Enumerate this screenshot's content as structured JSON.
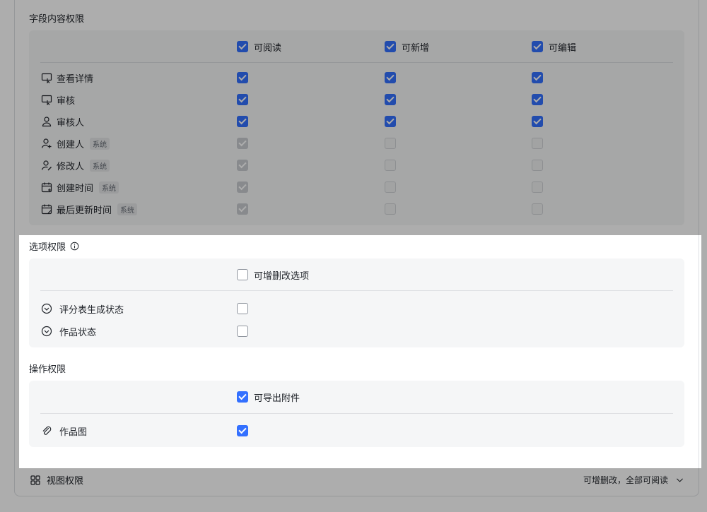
{
  "field_content": {
    "title": "字段内容权限",
    "columns": [
      {
        "label": "可阅读",
        "checked": true
      },
      {
        "label": "可新增",
        "checked": true
      },
      {
        "label": "可编辑",
        "checked": true
      }
    ],
    "rows": [
      {
        "label": "查看详情",
        "icon": "button-field-icon",
        "tag": "",
        "values": [
          true,
          true,
          true
        ],
        "disabled": false
      },
      {
        "label": "审核",
        "icon": "button-field-icon",
        "tag": "",
        "values": [
          true,
          true,
          true
        ],
        "disabled": false
      },
      {
        "label": "审核人",
        "icon": "person-icon",
        "tag": "",
        "values": [
          true,
          true,
          true
        ],
        "disabled": false
      },
      {
        "label": "创建人",
        "icon": "person-add-icon",
        "tag": "系统",
        "values": [
          true,
          false,
          false
        ],
        "disabled": true
      },
      {
        "label": "修改人",
        "icon": "person-edit-icon",
        "tag": "系统",
        "values": [
          true,
          false,
          false
        ],
        "disabled": true
      },
      {
        "label": "创建时间",
        "icon": "calendar-add-icon",
        "tag": "系统",
        "values": [
          true,
          false,
          false
        ],
        "disabled": true
      },
      {
        "label": "最后更新时间",
        "icon": "calendar-edit-icon",
        "tag": "系统",
        "values": [
          true,
          false,
          false
        ],
        "disabled": true
      }
    ]
  },
  "option_permissions": {
    "title": "选项权限",
    "header_label": "可增删改选项",
    "header_checked": false,
    "rows": [
      {
        "label": "评分表生成状态",
        "checked": false
      },
      {
        "label": "作品状态",
        "checked": false
      }
    ]
  },
  "operation_permissions": {
    "title": "操作权限",
    "header_label": "可导出附件",
    "header_checked": true,
    "rows": [
      {
        "label": "作品图",
        "checked": true
      }
    ]
  },
  "view_permissions": {
    "title": "视图权限",
    "summary": "可增删改，全部可阅读"
  },
  "colors": {
    "accent": "#3370ff",
    "section_bg": "#f5f6f7"
  }
}
